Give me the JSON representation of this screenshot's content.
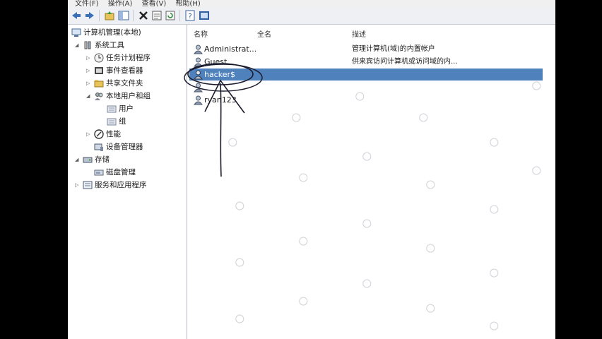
{
  "menu": [
    "文件(F)",
    "操作(A)",
    "查看(V)",
    "帮助(H)"
  ],
  "tree": {
    "root": "计算机管理(本地)",
    "system_tools": "系统工具",
    "task_scheduler": "任务计划程序",
    "event_viewer": "事件查看器",
    "shared_folders": "共享文件夹",
    "local_users": "本地用户和组",
    "users": "用户",
    "groups": "组",
    "performance": "性能",
    "device_manager": "设备管理器",
    "storage": "存储",
    "disk_management": "磁盘管理",
    "services": "服务和应用程序"
  },
  "columns": {
    "name": "名称",
    "fullname": "全名",
    "description": "描述"
  },
  "users": [
    {
      "name": "Administrat...",
      "description": "管理计算机(域)的内置帐户"
    },
    {
      "name": "Guest",
      "description": "供来宾访问计算机或访问域的内..."
    },
    {
      "name": "hacker$",
      "description": ""
    },
    {
      "name": "",
      "description": ""
    },
    {
      "name": "ryan123",
      "description": ""
    }
  ],
  "selected_user": "hacker$",
  "colors": {
    "selection": "#4f81bd",
    "annotation": "#1b1b2e"
  }
}
